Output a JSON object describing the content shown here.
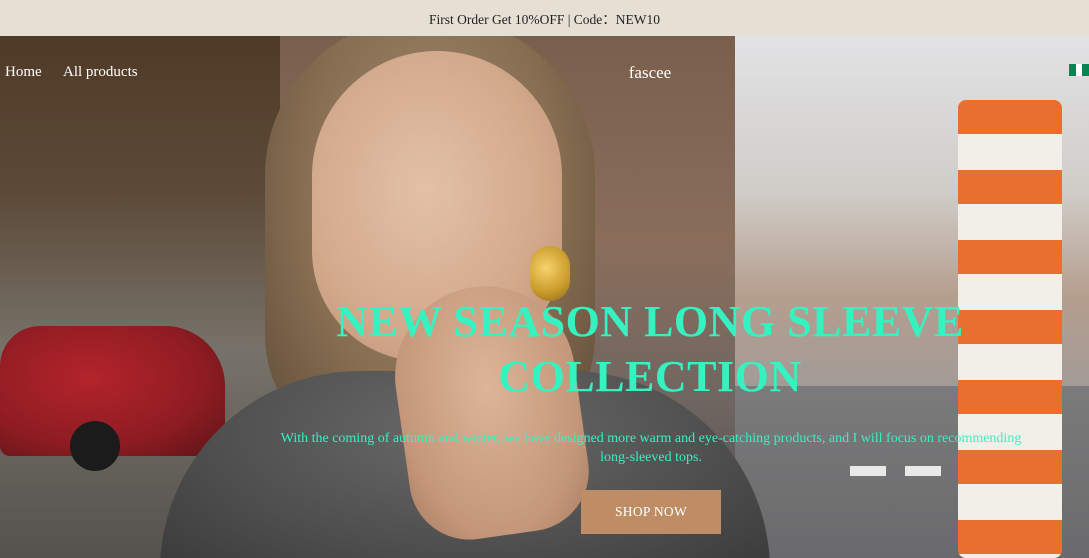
{
  "announcement": {
    "text": "First Order Get 10%OFF | Code：NEW10"
  },
  "nav": {
    "links": [
      {
        "label": "Home"
      },
      {
        "label": "All products"
      }
    ],
    "brand": "fascee",
    "flag_icon": "nigeria-flag-icon",
    "flag_colors": [
      "#008751",
      "#ffffff",
      "#008751"
    ]
  },
  "hero": {
    "headline": "NEW SEASON LONG SLEEVE COLLECTION",
    "subtext": "With the coming of autumn and winter, we have designed more warm and eye-catching products, and I will focus on recommending long-sleeved tops.",
    "cta_label": "SHOP NOW",
    "colors": {
      "headline": "#36f2c1",
      "cta_bg": "#bf8d63",
      "announcement_bg": "#e6dfd4"
    }
  }
}
